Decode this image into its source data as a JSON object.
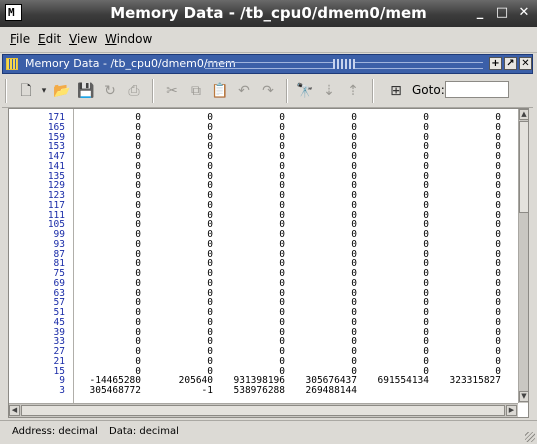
{
  "window": {
    "title": "Memory Data - /tb_cpu0/dmem0/mem"
  },
  "menu": [
    {
      "label": "File",
      "mn": "F",
      "rest": "ile"
    },
    {
      "label": "Edit",
      "mn": "E",
      "rest": "dit"
    },
    {
      "label": "View",
      "mn": "V",
      "rest": "iew"
    },
    {
      "label": "Window",
      "mn": "W",
      "rest": "indow"
    }
  ],
  "subwindow": {
    "title": "Memory Data - /tb_cpu0/dmem0/mem"
  },
  "toolbar": {
    "goto_label": "Goto:",
    "goto_value": "",
    "icons": [
      "new-file-icon",
      "dropdown-arrow-icon",
      "open-folder-icon",
      "save-icon",
      "reload-icon",
      "print-icon",
      "cut-icon",
      "copy-icon",
      "paste-icon",
      "undo-icon",
      "redo-icon",
      "find-icon",
      "find-next-icon",
      "find-previous-icon",
      "goto-icon"
    ]
  },
  "memory": {
    "rows": [
      {
        "addr": "171",
        "vals": [
          "0",
          "0",
          "0",
          "0",
          "0",
          "0"
        ]
      },
      {
        "addr": "165",
        "vals": [
          "0",
          "0",
          "0",
          "0",
          "0",
          "0"
        ]
      },
      {
        "addr": "159",
        "vals": [
          "0",
          "0",
          "0",
          "0",
          "0",
          "0"
        ]
      },
      {
        "addr": "153",
        "vals": [
          "0",
          "0",
          "0",
          "0",
          "0",
          "0"
        ]
      },
      {
        "addr": "147",
        "vals": [
          "0",
          "0",
          "0",
          "0",
          "0",
          "0"
        ]
      },
      {
        "addr": "141",
        "vals": [
          "0",
          "0",
          "0",
          "0",
          "0",
          "0"
        ]
      },
      {
        "addr": "135",
        "vals": [
          "0",
          "0",
          "0",
          "0",
          "0",
          "0"
        ]
      },
      {
        "addr": "129",
        "vals": [
          "0",
          "0",
          "0",
          "0",
          "0",
          "0"
        ]
      },
      {
        "addr": "123",
        "vals": [
          "0",
          "0",
          "0",
          "0",
          "0",
          "0"
        ]
      },
      {
        "addr": "117",
        "vals": [
          "0",
          "0",
          "0",
          "0",
          "0",
          "0"
        ]
      },
      {
        "addr": "111",
        "vals": [
          "0",
          "0",
          "0",
          "0",
          "0",
          "0"
        ]
      },
      {
        "addr": "105",
        "vals": [
          "0",
          "0",
          "0",
          "0",
          "0",
          "0"
        ]
      },
      {
        "addr": "99",
        "vals": [
          "0",
          "0",
          "0",
          "0",
          "0",
          "0"
        ]
      },
      {
        "addr": "93",
        "vals": [
          "0",
          "0",
          "0",
          "0",
          "0",
          "0"
        ]
      },
      {
        "addr": "87",
        "vals": [
          "0",
          "0",
          "0",
          "0",
          "0",
          "0"
        ]
      },
      {
        "addr": "81",
        "vals": [
          "0",
          "0",
          "0",
          "0",
          "0",
          "0"
        ]
      },
      {
        "addr": "75",
        "vals": [
          "0",
          "0",
          "0",
          "0",
          "0",
          "0"
        ]
      },
      {
        "addr": "69",
        "vals": [
          "0",
          "0",
          "0",
          "0",
          "0",
          "0"
        ]
      },
      {
        "addr": "63",
        "vals": [
          "0",
          "0",
          "0",
          "0",
          "0",
          "0"
        ]
      },
      {
        "addr": "57",
        "vals": [
          "0",
          "0",
          "0",
          "0",
          "0",
          "0"
        ]
      },
      {
        "addr": "51",
        "vals": [
          "0",
          "0",
          "0",
          "0",
          "0",
          "0"
        ]
      },
      {
        "addr": "45",
        "vals": [
          "0",
          "0",
          "0",
          "0",
          "0",
          "0"
        ]
      },
      {
        "addr": "39",
        "vals": [
          "0",
          "0",
          "0",
          "0",
          "0",
          "0"
        ]
      },
      {
        "addr": "33",
        "vals": [
          "0",
          "0",
          "0",
          "0",
          "0",
          "0"
        ]
      },
      {
        "addr": "27",
        "vals": [
          "0",
          "0",
          "0",
          "0",
          "0",
          "0"
        ]
      },
      {
        "addr": "21",
        "vals": [
          "0",
          "0",
          "0",
          "0",
          "0",
          "0"
        ]
      },
      {
        "addr": "15",
        "vals": [
          "0",
          "0",
          "0",
          "0",
          "0",
          "0"
        ]
      },
      {
        "addr": "9",
        "vals": [
          "-14465280",
          "205640",
          "931398196",
          "305676437",
          "691554134",
          "323315827"
        ]
      },
      {
        "addr": "3",
        "vals": [
          "305468772",
          "-1",
          "538976288",
          "269488144",
          "",
          ""
        ]
      }
    ]
  },
  "status": {
    "address_radix": "Address: decimal",
    "data_radix": "Data: decimal"
  }
}
